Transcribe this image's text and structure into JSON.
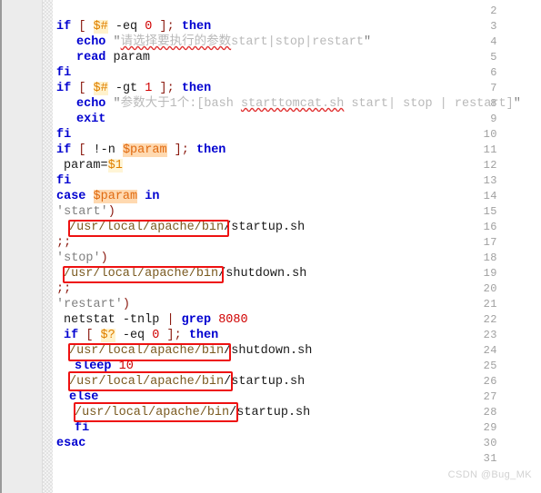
{
  "editor": {
    "first_line_number": 2,
    "last_line_number": 31,
    "watermark": "CSDN @Bug_MK",
    "colors": {
      "background": "#ffffff",
      "gutter": "#ececec",
      "line_number": "#a0a0a0",
      "keyword": "#0000d0",
      "punctuation": "#8b1a10",
      "variable": "#e08000",
      "variable_highlight": "#ffd9b0",
      "number": "#d00000",
      "string": "#b9b9b9",
      "path": "#7a5a20",
      "annotation_box": "#ee1111",
      "watermark": "#d2d2d2"
    }
  },
  "line_numbers": [
    2,
    3,
    4,
    5,
    6,
    7,
    8,
    9,
    10,
    11,
    12,
    13,
    14,
    15,
    16,
    17,
    18,
    19,
    20,
    21,
    22,
    23,
    24,
    25,
    26,
    27,
    28,
    29,
    30,
    31
  ],
  "code_lines": [
    {
      "n": 2,
      "text": ""
    },
    {
      "n": 3,
      "text": "if [ $# -eq 0 ]; then"
    },
    {
      "n": 4,
      "text": "  echo \"请选择要执行的参数start|stop|restart\""
    },
    {
      "n": 5,
      "text": "  read param"
    },
    {
      "n": 6,
      "text": "fi"
    },
    {
      "n": 7,
      "text": "if [ $# -gt 1 ]; then"
    },
    {
      "n": 8,
      "text": "  echo \"参数大于1个:[bash starttomcat.sh start| stop | restart]\""
    },
    {
      "n": 9,
      "text": "  exit"
    },
    {
      "n": 10,
      "text": "fi"
    },
    {
      "n": 11,
      "text": "if [ !-n $param ]; then"
    },
    {
      "n": 12,
      "text": " param=$1"
    },
    {
      "n": 13,
      "text": "fi"
    },
    {
      "n": 14,
      "text": "case $param in"
    },
    {
      "n": 15,
      "text": "'start')"
    },
    {
      "n": 16,
      "text": "  /usr/local/apache/bin/startup.sh"
    },
    {
      "n": 17,
      "text": ";;"
    },
    {
      "n": 18,
      "text": "'stop')"
    },
    {
      "n": 19,
      "text": " /usr/local/apache/bin/shutdown.sh"
    },
    {
      "n": 20,
      "text": ";;"
    },
    {
      "n": 21,
      "text": "'restart')"
    },
    {
      "n": 22,
      "text": " netstat -tnlp | grep 8080"
    },
    {
      "n": 23,
      "text": " if [ $? -eq 0 ]; then"
    },
    {
      "n": 24,
      "text": "  /usr/local/apache/bin/shutdown.sh"
    },
    {
      "n": 25,
      "text": "  sleep 10"
    },
    {
      "n": 26,
      "text": "  /usr/local/apache/bin/startup.sh"
    },
    {
      "n": 27,
      "text": "  else"
    },
    {
      "n": 28,
      "text": "   /usr/local/apache/bin/startup.sh"
    },
    {
      "n": 29,
      "text": "   fi"
    },
    {
      "n": 30,
      "text": "esac"
    },
    {
      "n": 31,
      "text": ""
    }
  ],
  "tokens": {
    "l3": {
      "if": "if",
      "ob": "[",
      "var": "$#",
      "op": "-eq",
      "num": "0",
      "cb": "]",
      "semi": ";",
      "then": "then"
    },
    "l4": {
      "echo": "echo",
      "quote": "\"",
      "cn": "请选择要执行的参数",
      "tail": "start|stop|restart",
      "endquote": "\""
    },
    "l5": {
      "read": "read",
      "arg": "param"
    },
    "l6": {
      "fi": "fi"
    },
    "l7": {
      "if": "if",
      "ob": "[",
      "var": "$#",
      "op": "-gt",
      "num": "1",
      "cb": "]",
      "semi": ";",
      "then": "then"
    },
    "l8": {
      "echo": "echo",
      "quote": "\"",
      "cn": "参数大于1个:[bash ",
      "script": "starttomcat.sh",
      "tail": " start| stop | restart]",
      "endquote": "\""
    },
    "l9": {
      "exit": "exit"
    },
    "l10": {
      "fi": "fi"
    },
    "l11": {
      "if": "if",
      "ob": "[",
      "op": "!-n",
      "var": "$param",
      "cb": "]",
      "semi": ";",
      "then": "then"
    },
    "l12": {
      "name": "param",
      "eq": "=",
      "var": "$1"
    },
    "l13": {
      "fi": "fi"
    },
    "l14": {
      "case": "case",
      "var": "$param",
      "in": "in"
    },
    "l15": {
      "label": "'start'",
      "paren": ")"
    },
    "l16": {
      "path": "/usr/local/apache/bin",
      "file": "/startup.sh"
    },
    "l17": {
      "sep": ";;"
    },
    "l18": {
      "label": "'stop'",
      "paren": ")"
    },
    "l19": {
      "path": "/usr/local/apache/bin",
      "file": "/shutdown.sh"
    },
    "l20": {
      "sep": ";;"
    },
    "l21": {
      "label": "'restart'",
      "paren": ")"
    },
    "l22": {
      "cmd": "netstat",
      "opt": "-tnlp",
      "pipe": "|",
      "grep": "grep",
      "port": "8080"
    },
    "l23": {
      "if": "if",
      "ob": "[",
      "var": "$?",
      "op": "-eq",
      "num": "0",
      "cb": "]",
      "semi": ";",
      "then": "then"
    },
    "l24": {
      "path": "/usr/local/apache/bin",
      "file": "/shutdown.sh"
    },
    "l25": {
      "sleep": "sleep",
      "num": "10"
    },
    "l26": {
      "path": "/usr/local/apache/bin",
      "file": "/startup.sh"
    },
    "l27": {
      "else": "else"
    },
    "l28": {
      "path": "/usr/local/apache/bin",
      "file": "/startup.sh"
    },
    "l29": {
      "fi": "fi"
    },
    "l30": {
      "esac": "esac"
    }
  },
  "annotations": [
    {
      "id": 1,
      "target_line": 16,
      "label": "/usr/local/apache/bin"
    },
    {
      "id": 2,
      "target_line": 19,
      "label": "/usr/local/apache/bin"
    },
    {
      "id": 3,
      "target_line": 24,
      "label": "/usr/local/apache/bin"
    },
    {
      "id": 4,
      "target_line": 26,
      "label": "/usr/local/apache/bin"
    },
    {
      "id": 5,
      "target_line": 28,
      "label": "/usr/local/apache/bin"
    }
  ]
}
